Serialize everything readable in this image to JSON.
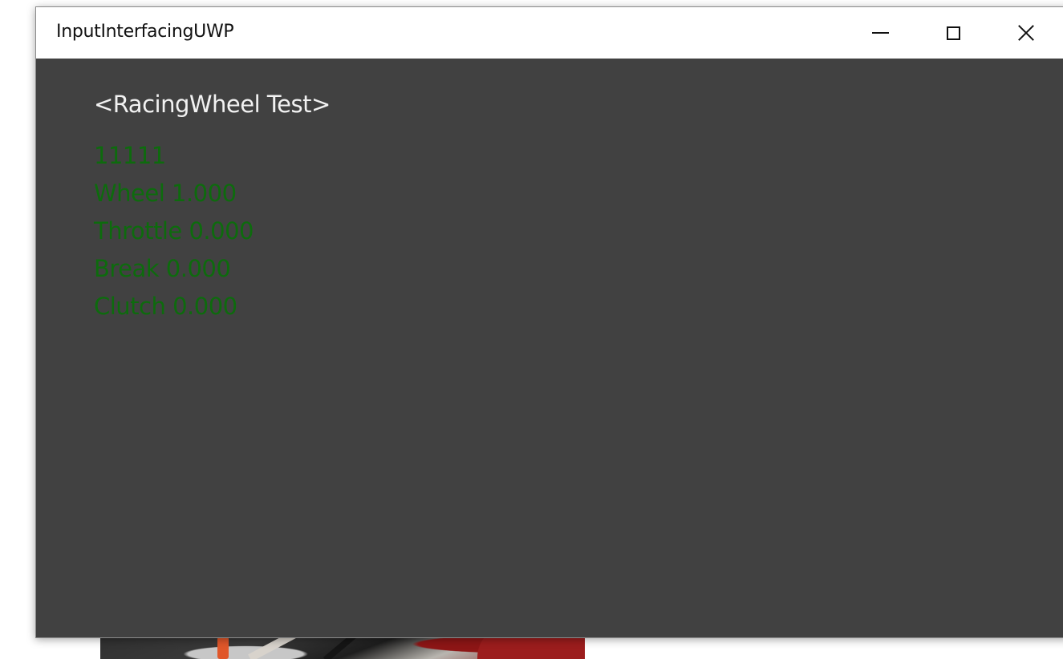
{
  "window": {
    "title": "InputInterfacingUWP",
    "controls": {
      "minimize_icon": "minimize-icon",
      "maximize_icon": "maximize-icon",
      "close_icon": "close-icon"
    }
  },
  "content": {
    "heading": "<RacingWheel Test>",
    "readouts": [
      "11111",
      "Wheel 1.000",
      "Throttle 0.000",
      "Break 0.000",
      "Clutch 0.000"
    ]
  },
  "colors": {
    "window_background": "#414141",
    "titlebar_background": "#ffffff",
    "heading_text": "#f2f2f2",
    "readout_text": "#0d6b0d"
  }
}
